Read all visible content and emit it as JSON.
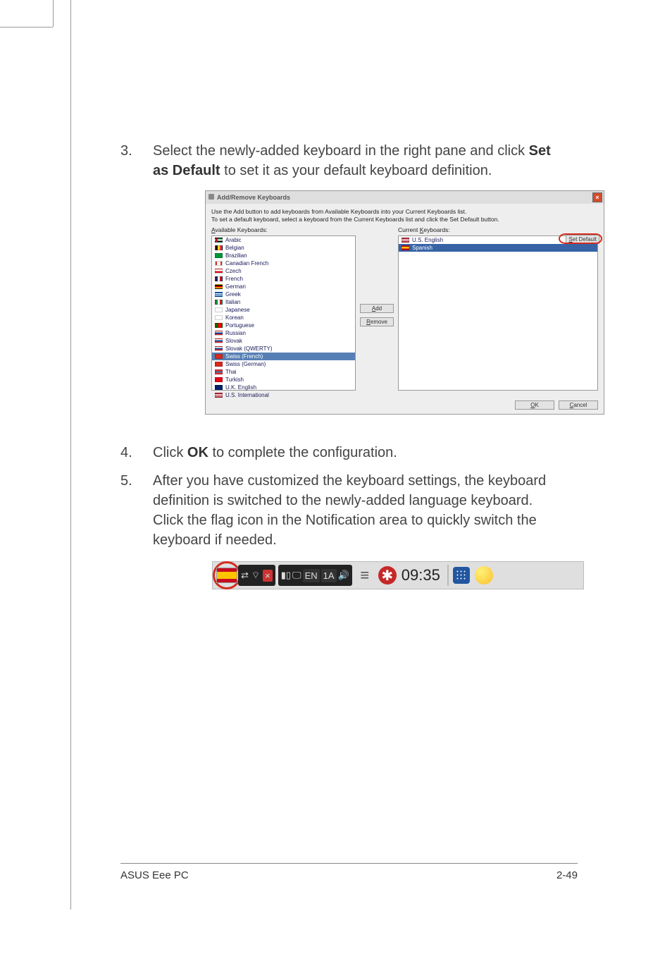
{
  "steps": {
    "s3": {
      "num": "3.",
      "text_a": "Select the newly-added keyboard in the right pane and click ",
      "bold_a": "Set as Default",
      "text_b": " to set it as your default keyboard definition."
    },
    "s4": {
      "num": "4.",
      "text_a": "Click ",
      "bold_a": "OK",
      "text_b": " to complete the configuration."
    },
    "s5": {
      "num": "5.",
      "text_a": "After you have customized the keyboard settings, the keyboard definition is switched to the newly-added language keyboard. Click the flag icon in the Notification area to quickly switch the keyboard if needed."
    }
  },
  "dialog": {
    "title": "Add/Remove Keyboards",
    "desc1": "Use the Add button to add keyboards from Available Keyboards into your Current Keyboards list.",
    "desc2": "To set a default keyboard, select a keyboard from the Current Keyboards list and click the Set Default button.",
    "left_label_pre": "A",
    "left_label_rest": "vailable Keyboards:",
    "right_label_pre": "Current ",
    "right_label_mid": "K",
    "right_label_rest": "eyboards:",
    "available": [
      {
        "flag": "f-ae",
        "name": "Arabic"
      },
      {
        "flag": "f-be",
        "name": "Belgian"
      },
      {
        "flag": "f-br",
        "name": "Brazilian"
      },
      {
        "flag": "f-ca",
        "name": "Canadian French"
      },
      {
        "flag": "f-cz",
        "name": "Czech"
      },
      {
        "flag": "f-fr",
        "name": "French"
      },
      {
        "flag": "f-de",
        "name": "German"
      },
      {
        "flag": "f-gr",
        "name": "Greek"
      },
      {
        "flag": "f-it",
        "name": "Italian"
      },
      {
        "flag": "f-jp",
        "name": "Japanese"
      },
      {
        "flag": "f-kr",
        "name": "Korean"
      },
      {
        "flag": "f-pt",
        "name": "Portuguese"
      },
      {
        "flag": "f-ru",
        "name": "Russian"
      },
      {
        "flag": "f-sk",
        "name": "Slovak"
      },
      {
        "flag": "f-sk",
        "name": "Slovak (QWERTY)"
      },
      {
        "flag": "f-ch",
        "name": "Swiss (French)",
        "sel": true
      },
      {
        "flag": "f-ch",
        "name": "Swiss (German)"
      },
      {
        "flag": "f-th",
        "name": "Thai"
      },
      {
        "flag": "f-tr",
        "name": "Turkish"
      },
      {
        "flag": "f-uk",
        "name": "U.K. English"
      },
      {
        "flag": "f-us",
        "name": "U.S. International"
      }
    ],
    "current": [
      {
        "flag": "f-us",
        "name": "U.S. English"
      },
      {
        "flag": "f-es-sm",
        "name": "Spanish",
        "sel": true
      }
    ],
    "btn_add_pre": "A",
    "btn_add_rest": "dd",
    "btn_remove_pre": "R",
    "btn_remove_rest": "emove",
    "btn_setdef_pre": "S",
    "btn_setdef_rest": "et Default",
    "btn_ok_pre": "O",
    "btn_ok_rest": "K",
    "btn_cancel_pre": "C",
    "btn_cancel_rest": "ancel"
  },
  "tray": {
    "en": "EN",
    "onea": "1A",
    "time": "09:35"
  },
  "footer": {
    "left": "ASUS Eee PC",
    "right": "2-49"
  }
}
